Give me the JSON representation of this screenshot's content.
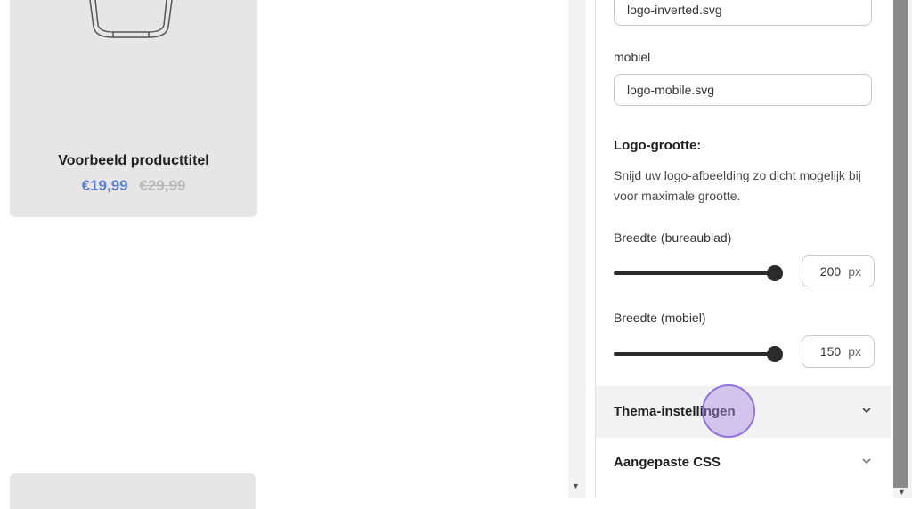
{
  "product": {
    "title": "Voorbeeld producttitel",
    "sale_price": "€19,99",
    "original_price": "€29,99"
  },
  "logo_settings": {
    "inverted_file": "logo-inverted.svg",
    "mobile_label": "mobiel",
    "mobile_file": "logo-mobile.svg",
    "size_heading": "Logo-grootte:",
    "size_help": "Snijd uw logo-afbeelding zo dicht mogelijk bij voor maximale grootte.",
    "desktop_width": {
      "label": "Breedte (bureaublad)",
      "value": "200",
      "unit": "px",
      "slider_level": 1.0
    },
    "mobile_width": {
      "label": "Breedte (mobiel)",
      "value": "150",
      "unit": "px",
      "slider_level": 1.0
    }
  },
  "accordions": [
    {
      "title": "Thema-instellingen",
      "icon": "chevron-down-icon"
    },
    {
      "title": "Aangepaste CSS",
      "icon": "chevron-down-icon"
    }
  ],
  "colors": {
    "sale_price": "#5b7fd6",
    "click_indicator": "#8f73d8"
  }
}
